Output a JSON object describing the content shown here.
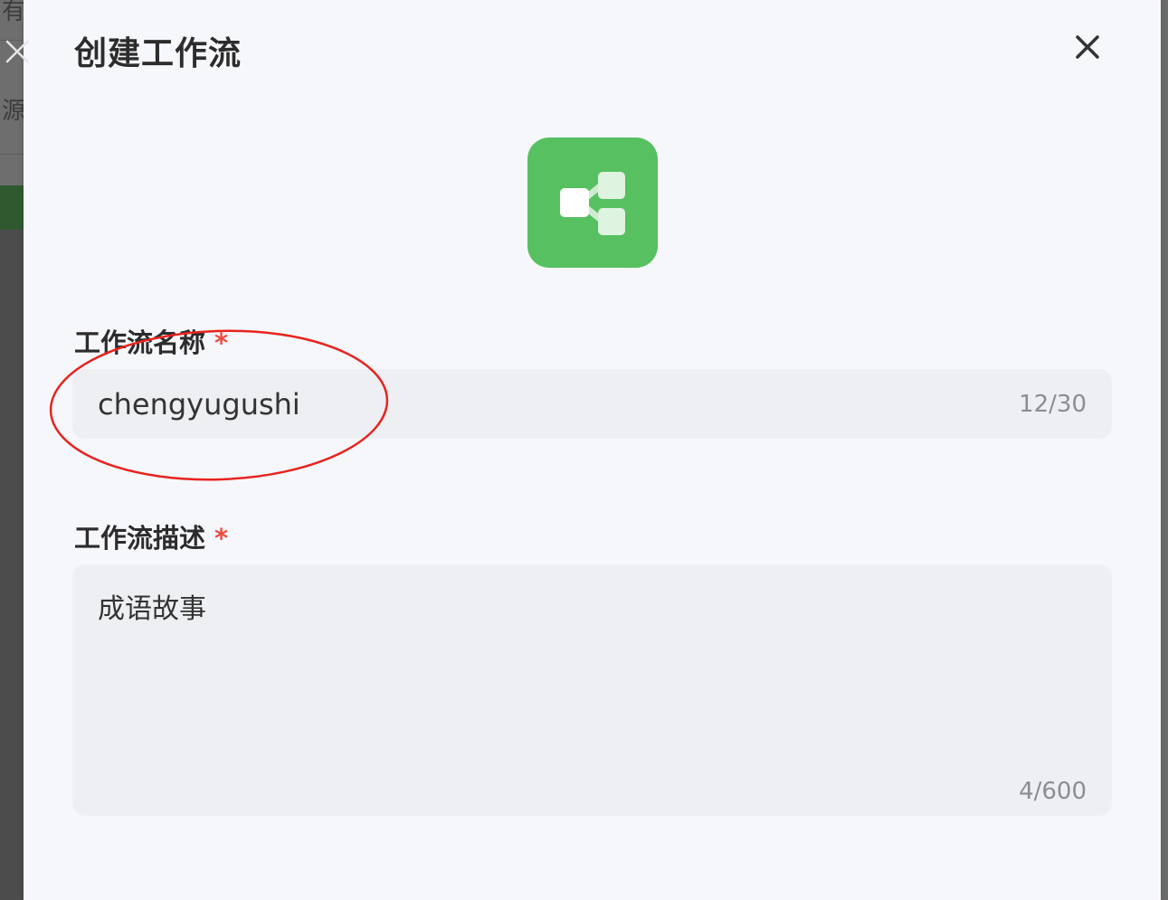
{
  "background": {
    "chars": [
      "有",
      "源"
    ]
  },
  "modal": {
    "title": "创建工作流",
    "close_icon": "close-icon",
    "workflow_icon": "workflow-icon",
    "accent_color": "#57c061"
  },
  "form": {
    "name": {
      "label": "工作流名称",
      "required": "*",
      "value": "chengyugushi",
      "counter": "12/30"
    },
    "description": {
      "label": "工作流描述",
      "required": "*",
      "value": "成语故事",
      "counter": "4/600"
    }
  },
  "side_panel": {
    "close_icon": "close-icon"
  },
  "annotation": {
    "shape": "ellipse",
    "color": "#e8231f"
  }
}
